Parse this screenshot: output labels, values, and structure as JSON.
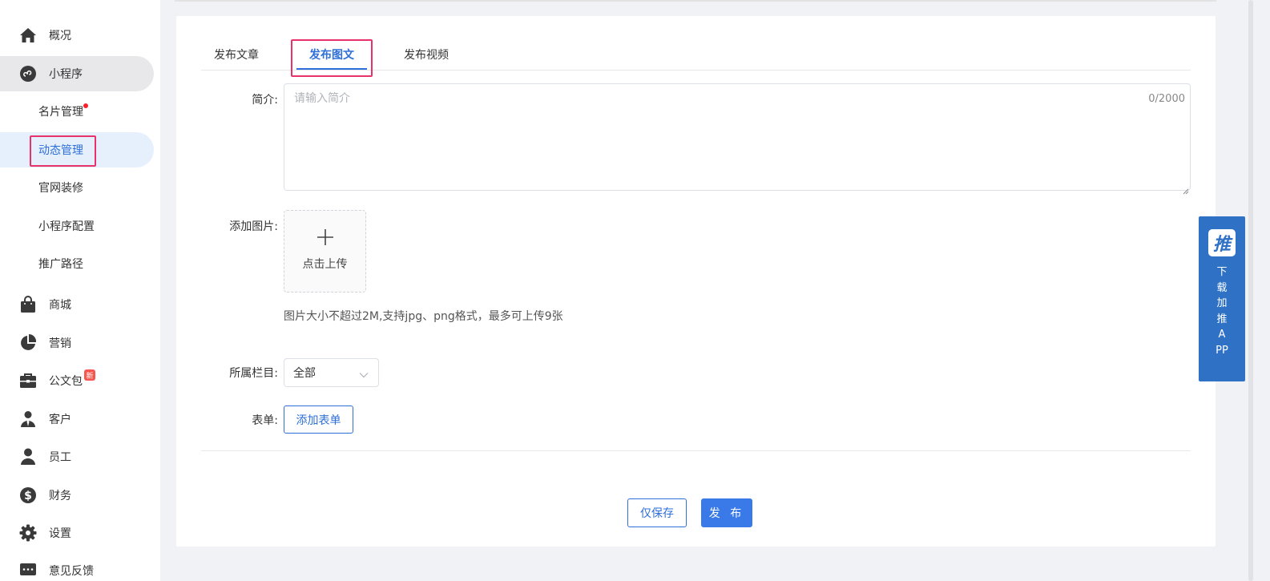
{
  "sidebar": {
    "items": [
      {
        "label": "概况",
        "icon": "home-icon"
      },
      {
        "label": "小程序",
        "icon": "miniprogram-icon"
      },
      {
        "label": "商城",
        "icon": "shopping-bag-icon"
      },
      {
        "label": "营销",
        "icon": "pie-chart-icon"
      },
      {
        "label": "公文包",
        "icon": "briefcase-icon"
      },
      {
        "label": "客户",
        "icon": "customer-icon"
      },
      {
        "label": "员工",
        "icon": "user-icon"
      },
      {
        "label": "财务",
        "icon": "dollar-icon"
      },
      {
        "label": "设置",
        "icon": "gear-icon"
      },
      {
        "label": "意见反馈",
        "icon": "message-icon"
      }
    ],
    "sub_items": [
      {
        "label": "名片管理"
      },
      {
        "label": "动态管理"
      },
      {
        "label": "官网装修"
      },
      {
        "label": "小程序配置"
      },
      {
        "label": "推广路径"
      }
    ],
    "new_badge": "新"
  },
  "tabs": [
    {
      "label": "发布文章"
    },
    {
      "label": "发布图文"
    },
    {
      "label": "发布视频"
    }
  ],
  "form": {
    "intro_label": "简介:",
    "intro_placeholder": "请输入简介",
    "intro_counter": "0/2000",
    "images_label": "添加图片:",
    "upload_label": "点击上传",
    "upload_hint": "图片大小不超过2M,支持jpg、png格式，最多可上传9张",
    "column_label": "所属栏目:",
    "column_value": "全部",
    "form_label": "表单:",
    "add_form_button": "添加表单"
  },
  "actions": {
    "save_only": "仅保存",
    "publish": "发 布"
  },
  "float_widget": {
    "logo_char": "推",
    "text": "下载加推APP"
  },
  "colors": {
    "accent": "#2e6fd9",
    "highlight_box": "#e8326a",
    "float_bg": "#2f72c5"
  }
}
